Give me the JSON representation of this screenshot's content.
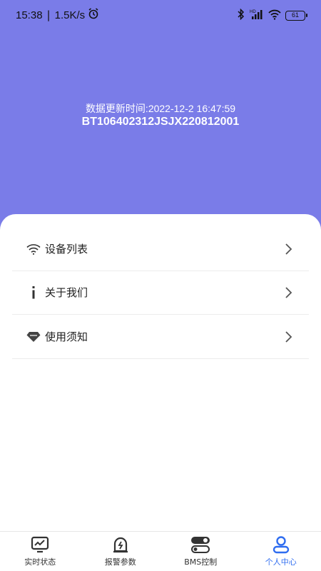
{
  "status_bar": {
    "time": "15:38",
    "separator": "|",
    "net_speed": "1.5K/s",
    "battery": "61",
    "icons": [
      "alarm-icon",
      "bluetooth-icon",
      "signal-hd-icon",
      "wifi-icon",
      "battery-icon"
    ]
  },
  "header": {
    "update_time_text": "数据更新时间:2022-12-2 16:47:59",
    "device_id": "BT106402312JSJX220812001",
    "background_color": "#7a7ce8"
  },
  "menu": {
    "items": [
      {
        "label": "设备列表",
        "icon": "wifi-icon"
      },
      {
        "label": "关于我们",
        "icon": "info-icon"
      },
      {
        "label": "使用须知",
        "icon": "diamond-icon"
      }
    ]
  },
  "tabbar": {
    "tabs": [
      {
        "label": "实时状态",
        "icon": "monitor-icon",
        "active": false
      },
      {
        "label": "报警参数",
        "icon": "alarm-bell-icon",
        "active": false
      },
      {
        "label": "BMS控制",
        "icon": "toggle-icon",
        "active": false
      },
      {
        "label": "个人中心",
        "icon": "user-icon",
        "active": true
      }
    ],
    "active_color": "#2f6df0"
  }
}
